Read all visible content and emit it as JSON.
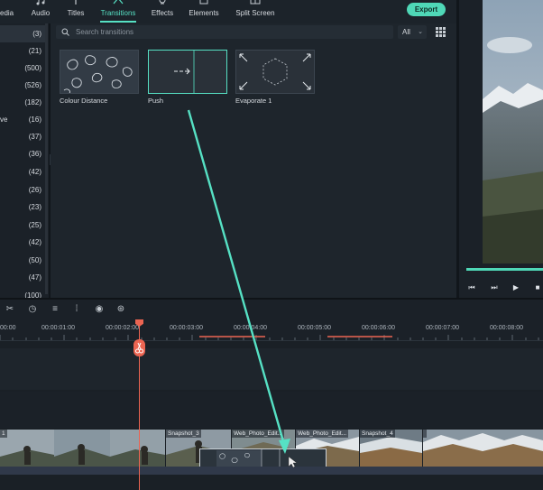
{
  "tabs": [
    {
      "label": "edia",
      "icon": "media-icon"
    },
    {
      "label": "Audio",
      "icon": "music-note-icon"
    },
    {
      "label": "Titles",
      "icon": "text-icon"
    },
    {
      "label": "Transitions",
      "icon": "transitions-icon",
      "active": true
    },
    {
      "label": "Effects",
      "icon": "sparkle-icon"
    },
    {
      "label": "Elements",
      "icon": "elements-icon"
    },
    {
      "label": "Split Screen",
      "icon": "split-screen-icon"
    }
  ],
  "export_label": "Export",
  "sidebar": {
    "items": [
      {
        "count": "(3)"
      },
      {
        "count": "(21)"
      },
      {
        "count": "(500)"
      },
      {
        "count": "(526)"
      },
      {
        "count": "(182)"
      },
      {
        "prefix": "ve",
        "count": "(16)"
      },
      {
        "count": "(37)"
      },
      {
        "count": "(36)"
      },
      {
        "count": "(42)"
      },
      {
        "count": "(26)"
      },
      {
        "count": "(23)"
      },
      {
        "count": "(25)"
      },
      {
        "count": "(42)"
      },
      {
        "count": "(50)"
      },
      {
        "count": "(47)"
      },
      {
        "count": "(100)"
      }
    ]
  },
  "search": {
    "placeholder": "Search transitions"
  },
  "filter": {
    "value": "All"
  },
  "transitions": [
    {
      "name": "Colour Distance"
    },
    {
      "name": "Push"
    },
    {
      "name": "Evaporate 1"
    }
  ],
  "timeline": {
    "ticks": [
      "00:00",
      "00:00:01:00",
      "00:00:02:00",
      "00:00:03:00",
      "00:00:04:00",
      "00:00:05:00",
      "00:00:06:00",
      "00:00:07:00",
      "00:00:08:00"
    ],
    "clips": [
      "1",
      "Snapshot_3",
      "Web_Photo_Edit...",
      "Web_Photo_Edit...",
      "Snapshot_4",
      ""
    ]
  },
  "colors": {
    "accent": "#56e1c4",
    "playhead": "#ec6552",
    "export": "#4fd8b7"
  }
}
